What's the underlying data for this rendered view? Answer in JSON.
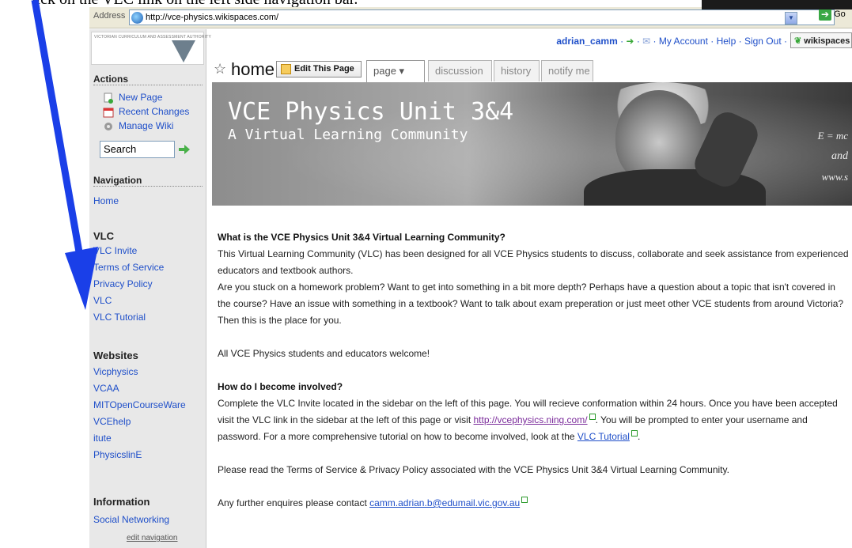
{
  "instruction": "lick on the VLC link on the left side navigation bar.",
  "addressbar": {
    "label": "Address",
    "url": "http://vce-physics.wikispaces.com/",
    "go_label": "Go"
  },
  "logo": {
    "text": "VICTORIAN CURRICULUM AND ASSESSMENT AUTHORITY"
  },
  "sidebar": {
    "actions_heading": "Actions",
    "actions": [
      {
        "label": "New Page",
        "icon": "new-page-icon"
      },
      {
        "label": "Recent Changes",
        "icon": "calendar-icon"
      },
      {
        "label": "Manage Wiki",
        "icon": "gear-icon"
      }
    ],
    "search_value": "Search",
    "navigation_heading": "Navigation",
    "home_link": "Home",
    "vlc_heading": "VLC",
    "vlc_links": [
      "VLC Invite",
      "Terms of Service",
      "Privacy Policy",
      "VLC",
      "VLC Tutorial"
    ],
    "websites_heading": "Websites",
    "website_links": [
      "Vicphysics",
      "VCAA",
      "MITOpenCourseWare",
      "VCEhelp",
      "itute",
      "PhysicslinE"
    ],
    "information_heading": "Information",
    "information_links": [
      "Social Networking"
    ],
    "edit_navigation": "edit navigation"
  },
  "userbar": {
    "username": "adrian_camm",
    "sep1": " · ",
    "my_account": "My Account",
    "help": "Help",
    "sign_out": "Sign Out",
    "sep": " · ",
    "wikispaces": "wikispaces"
  },
  "page": {
    "title": "home",
    "edit_button": "Edit This Page",
    "tabs": [
      "page ▾",
      "discussion",
      "history",
      "notify me"
    ]
  },
  "banner": {
    "title": "VCE Physics Unit 3&4",
    "subtitle": "A Virtual Learning Community",
    "board_lines": [
      "E = mc",
      "and",
      "www.s"
    ]
  },
  "content": {
    "heading1": "What is the VCE Physics Unit 3&4 Virtual Learning Community?",
    "para1": "This Virtual Learning Community (VLC) has been designed for all VCE Physics students to discuss, collaborate and seek assistance from experienced educators and textbook authors.",
    "para2": "Are you stuck on a homework problem? Want to get into something in a bit more depth? Perhaps have a question about a topic that isn't covered in the course? Have an issue with something in a textbook? Want to talk about exam preperation or just meet other VCE students from around Victoria? Then this is the place for you.",
    "para3": "All VCE Physics students and educators welcome!",
    "heading2": "How do I become involved?",
    "para4a": "Complete the VLC Invite located in the sidebar on the left of this page. You will recieve conformation within 24 hours. Once you have been accepted visit the VLC link in the sidebar at the left of this page or visit ",
    "para4_link": "http://vcephysics.ning.com/",
    "para4b": ". You will be prompted to enter your username and password. For a more comprehensive tutorial on how to become involved, look at the ",
    "para4_link2": "VLC Tutorial",
    "para4c": ".",
    "para5": "Please read the Terms of Service & Privacy Policy associated with the VCE Physics Unit 3&4 Virtual Learning Community.",
    "para6": "Any further enquires please contact ",
    "email": "camm.adrian.b@edumail.vic.gov.au"
  },
  "colors": {
    "link": "#1f4fc9",
    "arrow": "#1a3fe8",
    "sidebar_bg": "#e8e8e8"
  }
}
